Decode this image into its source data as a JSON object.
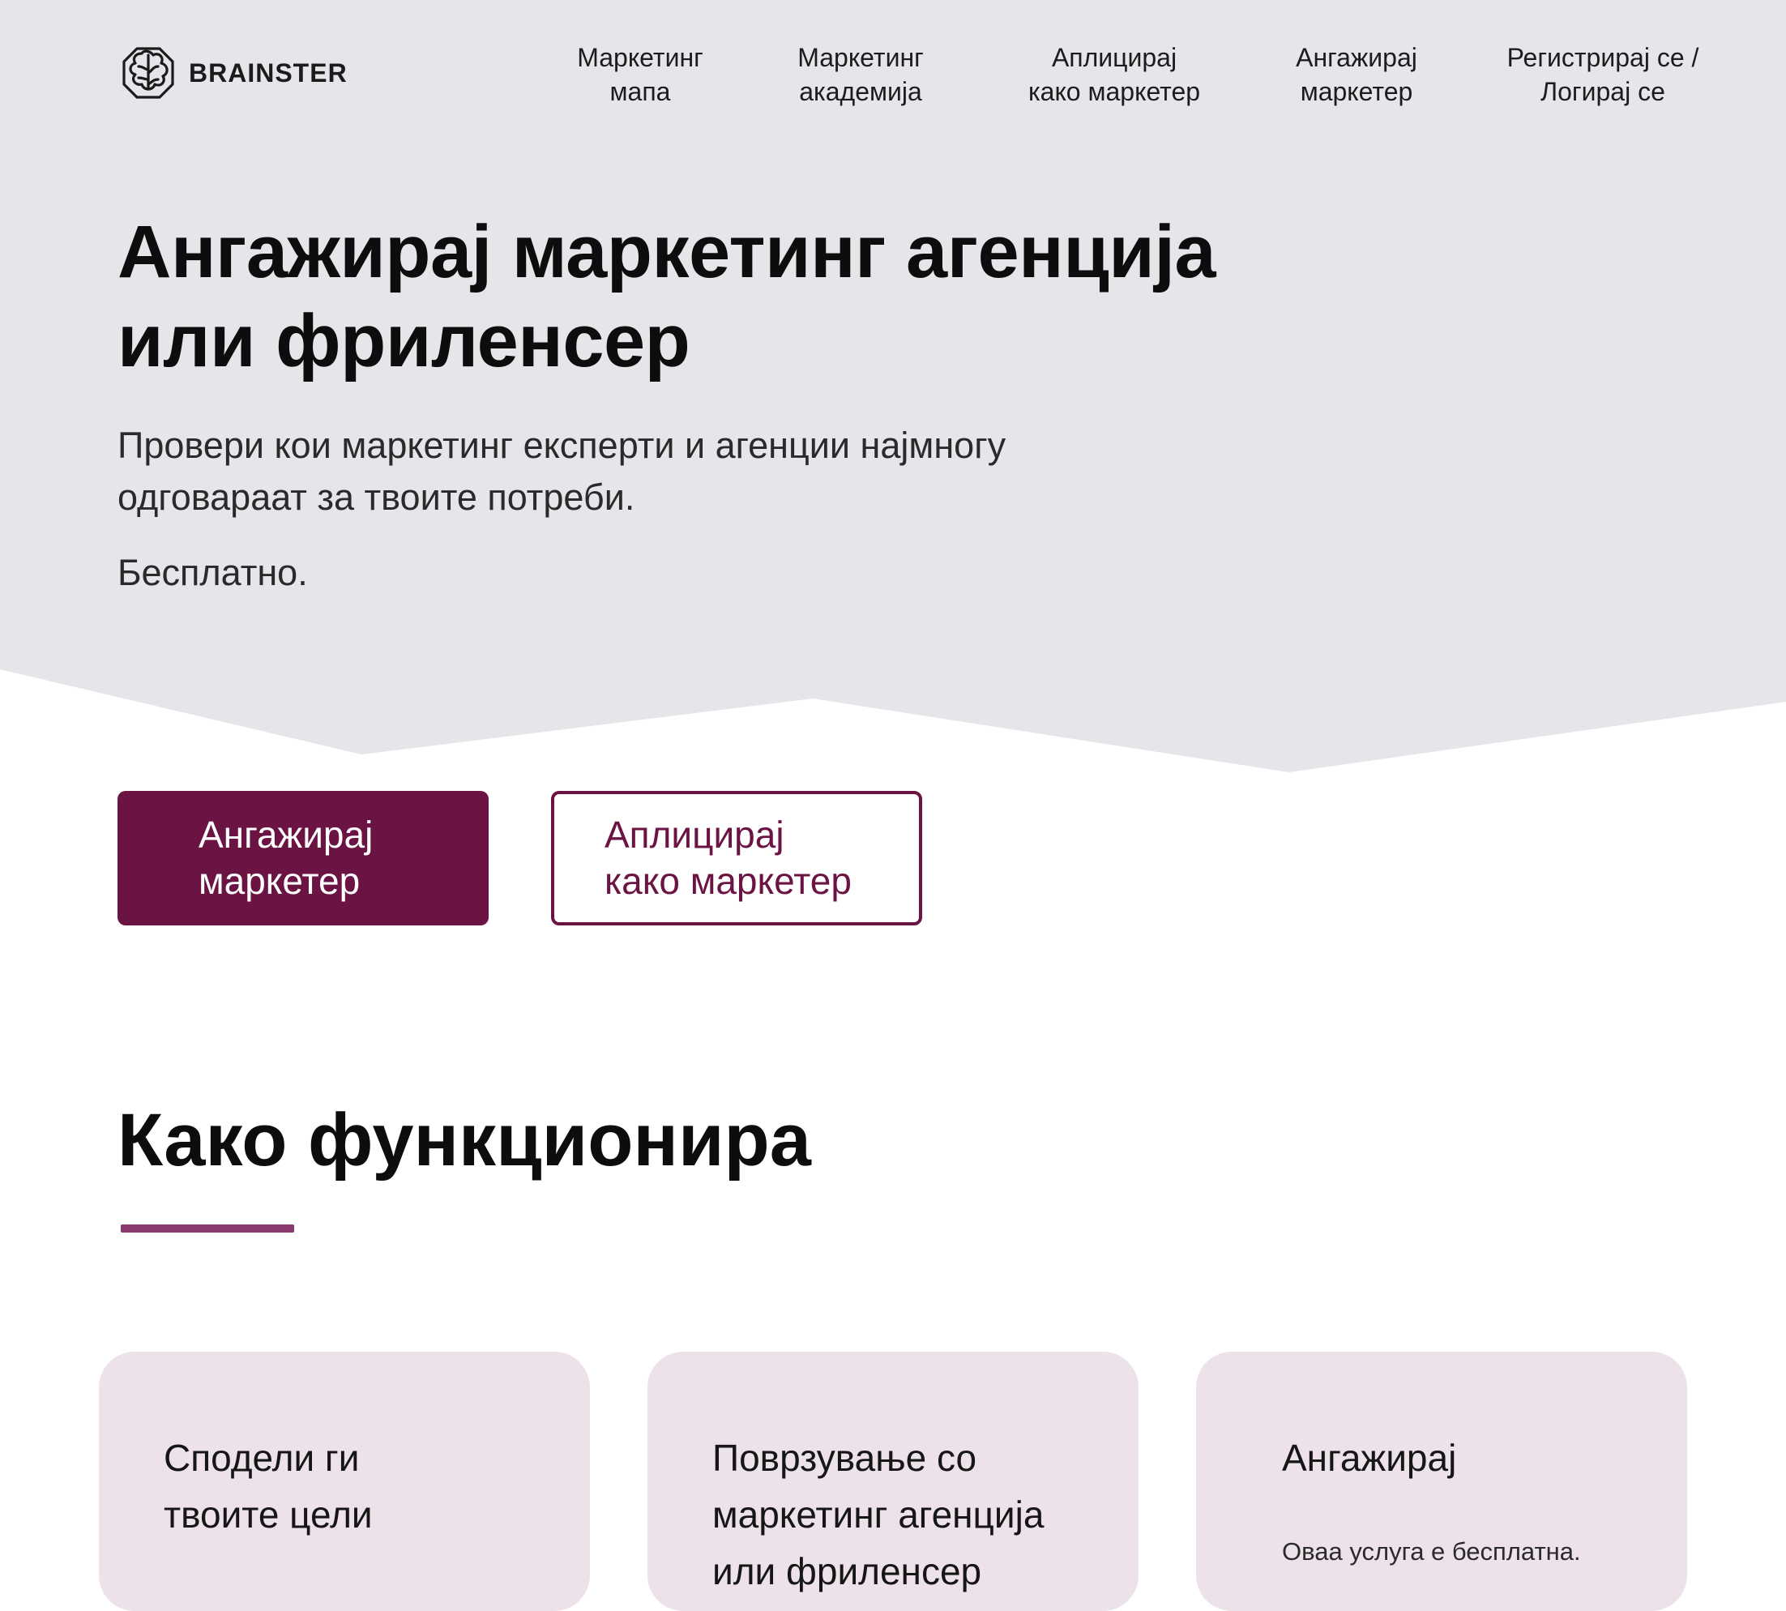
{
  "header": {
    "logo_text": "BRAINSTER",
    "nav": [
      {
        "line1": "Маркетинг",
        "line2": "мапа"
      },
      {
        "line1": "Маркетинг",
        "line2": "академија"
      },
      {
        "line1": "Аплицирај",
        "line2": "како маркетер"
      },
      {
        "line1": "Ангажирај",
        "line2": "маркетер"
      },
      {
        "line1": "Регистрирај се /",
        "line2": "Логирај се"
      }
    ]
  },
  "hero": {
    "title_line1": "Ангажирај маркетинг агенција",
    "title_line2": "или фриленсер",
    "subtitle_line1": "Провери кои маркетинг експерти и агенции најмногу",
    "subtitle_line2": "одговараат за твоите потреби.",
    "free_text": "Бесплатно.",
    "background_color": "#e5e6ea"
  },
  "buttons": {
    "hire": {
      "line1": "Ангажирај",
      "line2": "маркетер"
    },
    "apply": {
      "line1": "Аплицирај",
      "line2": "како маркетер"
    }
  },
  "how_it_works": {
    "title": "Како функционира",
    "cards": [
      {
        "title_lines": [
          "Сподели ги",
          "твоите цели"
        ]
      },
      {
        "title_lines": [
          "Поврзување со",
          "маркетинг агенција",
          "или фриленсер"
        ]
      },
      {
        "title_lines": [
          "Ангажирај"
        ],
        "description": "Оваа услуга е бесплатна."
      }
    ]
  },
  "colors": {
    "brand": "#6b1444",
    "accent_underline": "#8a3a6c",
    "card_background": "#ede2ea"
  }
}
